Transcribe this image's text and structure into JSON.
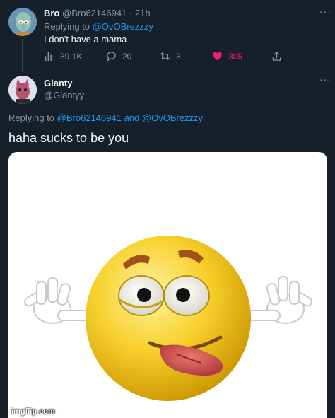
{
  "tweet1": {
    "name": "Bro",
    "handle": "@Bro62146941",
    "separator": "·",
    "time": "21h",
    "replying_prefix": "Replying to",
    "replying_to": "@OvOBrezzzy",
    "text": "I don't have a mama",
    "views": "39.1K",
    "replies": "20",
    "retweets": "3",
    "likes": "305",
    "like_color": "#f91880"
  },
  "tweet2": {
    "name": "Glanty",
    "handle": "@Glantyy",
    "replying_prefix": "Replying to",
    "replying_to_1": "@Bro62146941",
    "replying_and": "and",
    "replying_to_2": "@OvOBrezzzy",
    "text": "haha sucks to be you"
  },
  "media": {
    "watermark": "imgflip.com"
  },
  "colors": {
    "background": "#15202b",
    "link": "#1d9bf0",
    "muted": "#8b98a5"
  }
}
